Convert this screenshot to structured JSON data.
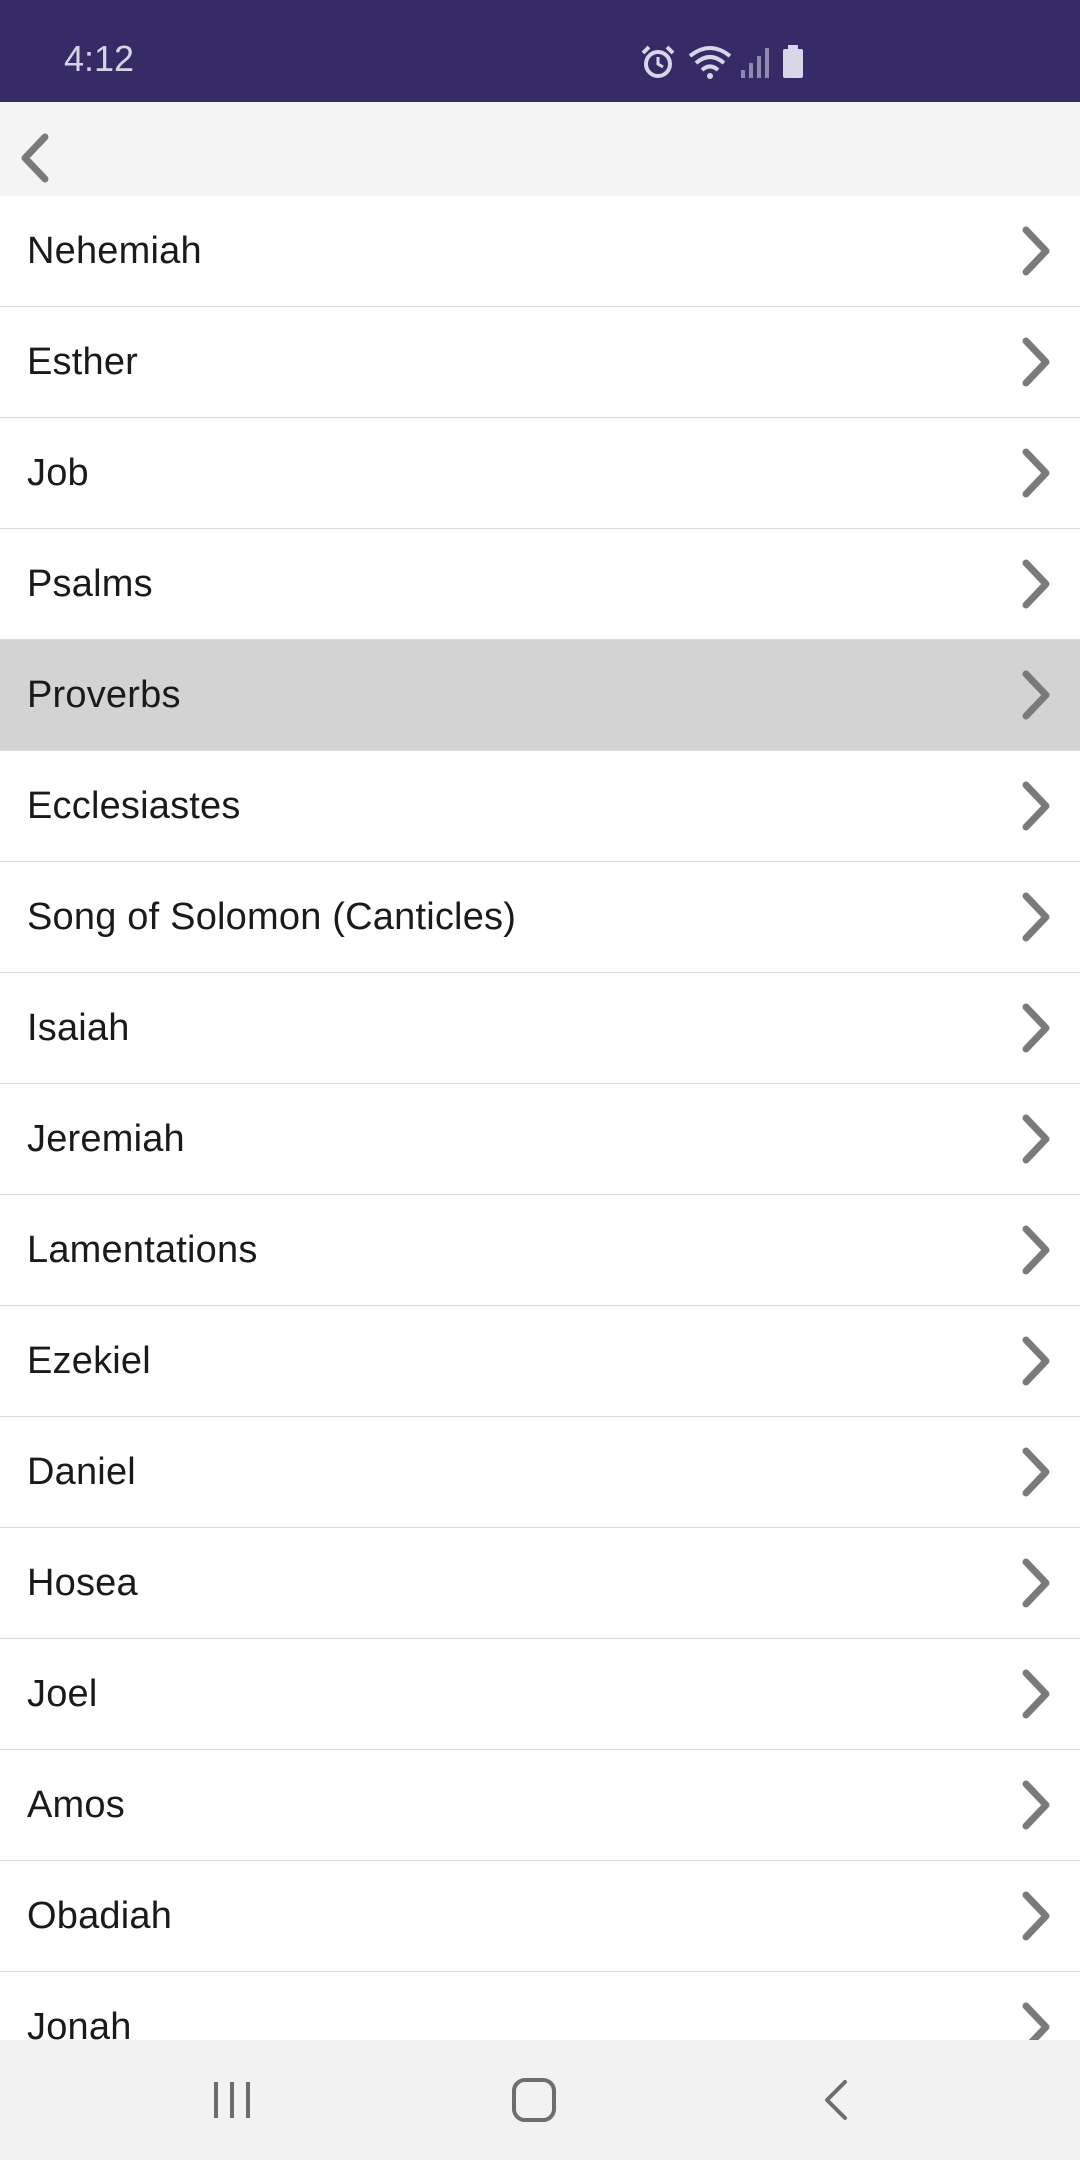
{
  "status_bar": {
    "time": "4:12",
    "icons": [
      "alarm-icon",
      "wifi-icon",
      "signal-icon",
      "battery-icon"
    ]
  },
  "app_bar": {
    "back_icon": "chevron-left-icon"
  },
  "list": {
    "selected_index": 4,
    "items": [
      {
        "label": "Nehemiah"
      },
      {
        "label": "Esther"
      },
      {
        "label": "Job"
      },
      {
        "label": "Psalms"
      },
      {
        "label": "Proverbs"
      },
      {
        "label": "Ecclesiastes"
      },
      {
        "label": "Song of Solomon (Canticles)"
      },
      {
        "label": "Isaiah"
      },
      {
        "label": "Jeremiah"
      },
      {
        "label": "Lamentations"
      },
      {
        "label": "Ezekiel"
      },
      {
        "label": "Daniel"
      },
      {
        "label": "Hosea"
      },
      {
        "label": "Joel"
      },
      {
        "label": "Amos"
      },
      {
        "label": "Obadiah"
      },
      {
        "label": "Jonah"
      }
    ]
  },
  "nav_bar": {
    "buttons": [
      "recent-apps-icon",
      "home-icon",
      "back-icon"
    ]
  },
  "colors": {
    "status_bar": "#372b67",
    "selected_row": "#d3d3d3",
    "chevron": "#7a7a7a"
  }
}
